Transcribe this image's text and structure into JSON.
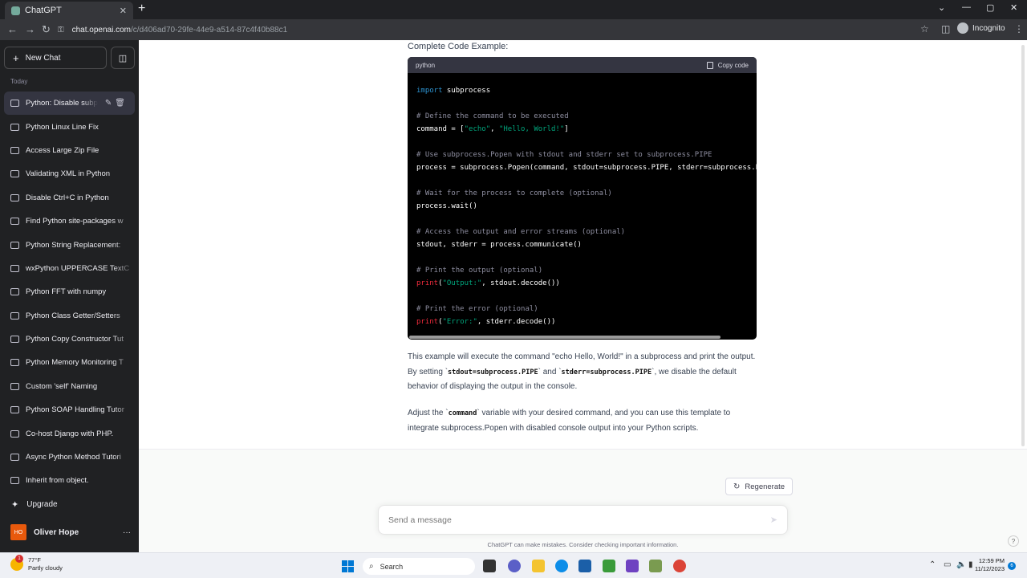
{
  "browser": {
    "tab_title": "ChatGPT",
    "url_host": "chat.openai.com",
    "url_path": "/c/d406ad70-29fe-44e9-a514-87c4f40b88c1",
    "profile_label": "Incognito"
  },
  "sidebar": {
    "new_chat_label": "New Chat",
    "section_label": "Today",
    "conversations": [
      "Python: Disable subprocess output",
      "Python Linux Line Fix",
      "Access Large Zip File",
      "Validating XML in Python",
      "Disable Ctrl+C in Python",
      "Find Python site-packages w",
      "Python String Replacement:",
      "wxPython UPPERCASE TextC",
      "Python FFT with numpy",
      "Python Class Getter/Setters",
      "Python Copy Constructor Tut",
      "Python Memory Monitoring T",
      "Custom 'self' Naming",
      "Python SOAP Handling Tutor",
      "Co-host Django with PHP.",
      "Async Python Method Tutori",
      "Inherit from object."
    ],
    "upgrade_label": "Upgrade",
    "user_initials": "HO",
    "user_name": "Oliver Hope"
  },
  "answer": {
    "heading": "Complete Code Example:",
    "code_lang": "python",
    "copy_label": "Copy code",
    "para1_part1": "This example will execute the command \"echo Hello, World!\" in a subprocess and print the output. By setting `",
    "para1_code1": "stdout=subprocess.PIPE",
    "para1_part2": "` and `",
    "para1_code2": "stderr=subprocess.PIPE",
    "para1_part3": "`, we disable the default behavior of displaying the output in the console.",
    "para2_part1": "Adjust the `",
    "para2_code": "command",
    "para2_part2": "` variable with your desired command, and you can use this template to integrate subprocess.Popen with disabled console output into your Python scripts."
  },
  "composer": {
    "regenerate_label": "Regenerate",
    "placeholder": "Send a message",
    "disclaimer": "ChatGPT can make mistakes. Consider checking important information.",
    "help_label": "?"
  },
  "taskbar": {
    "weather_temp": "77°F",
    "weather_desc": "Partly cloudy",
    "weather_badge": "1",
    "search_label": "Search",
    "time": "12:59 PM",
    "date": "11/12/2023",
    "notif_count": "6"
  }
}
